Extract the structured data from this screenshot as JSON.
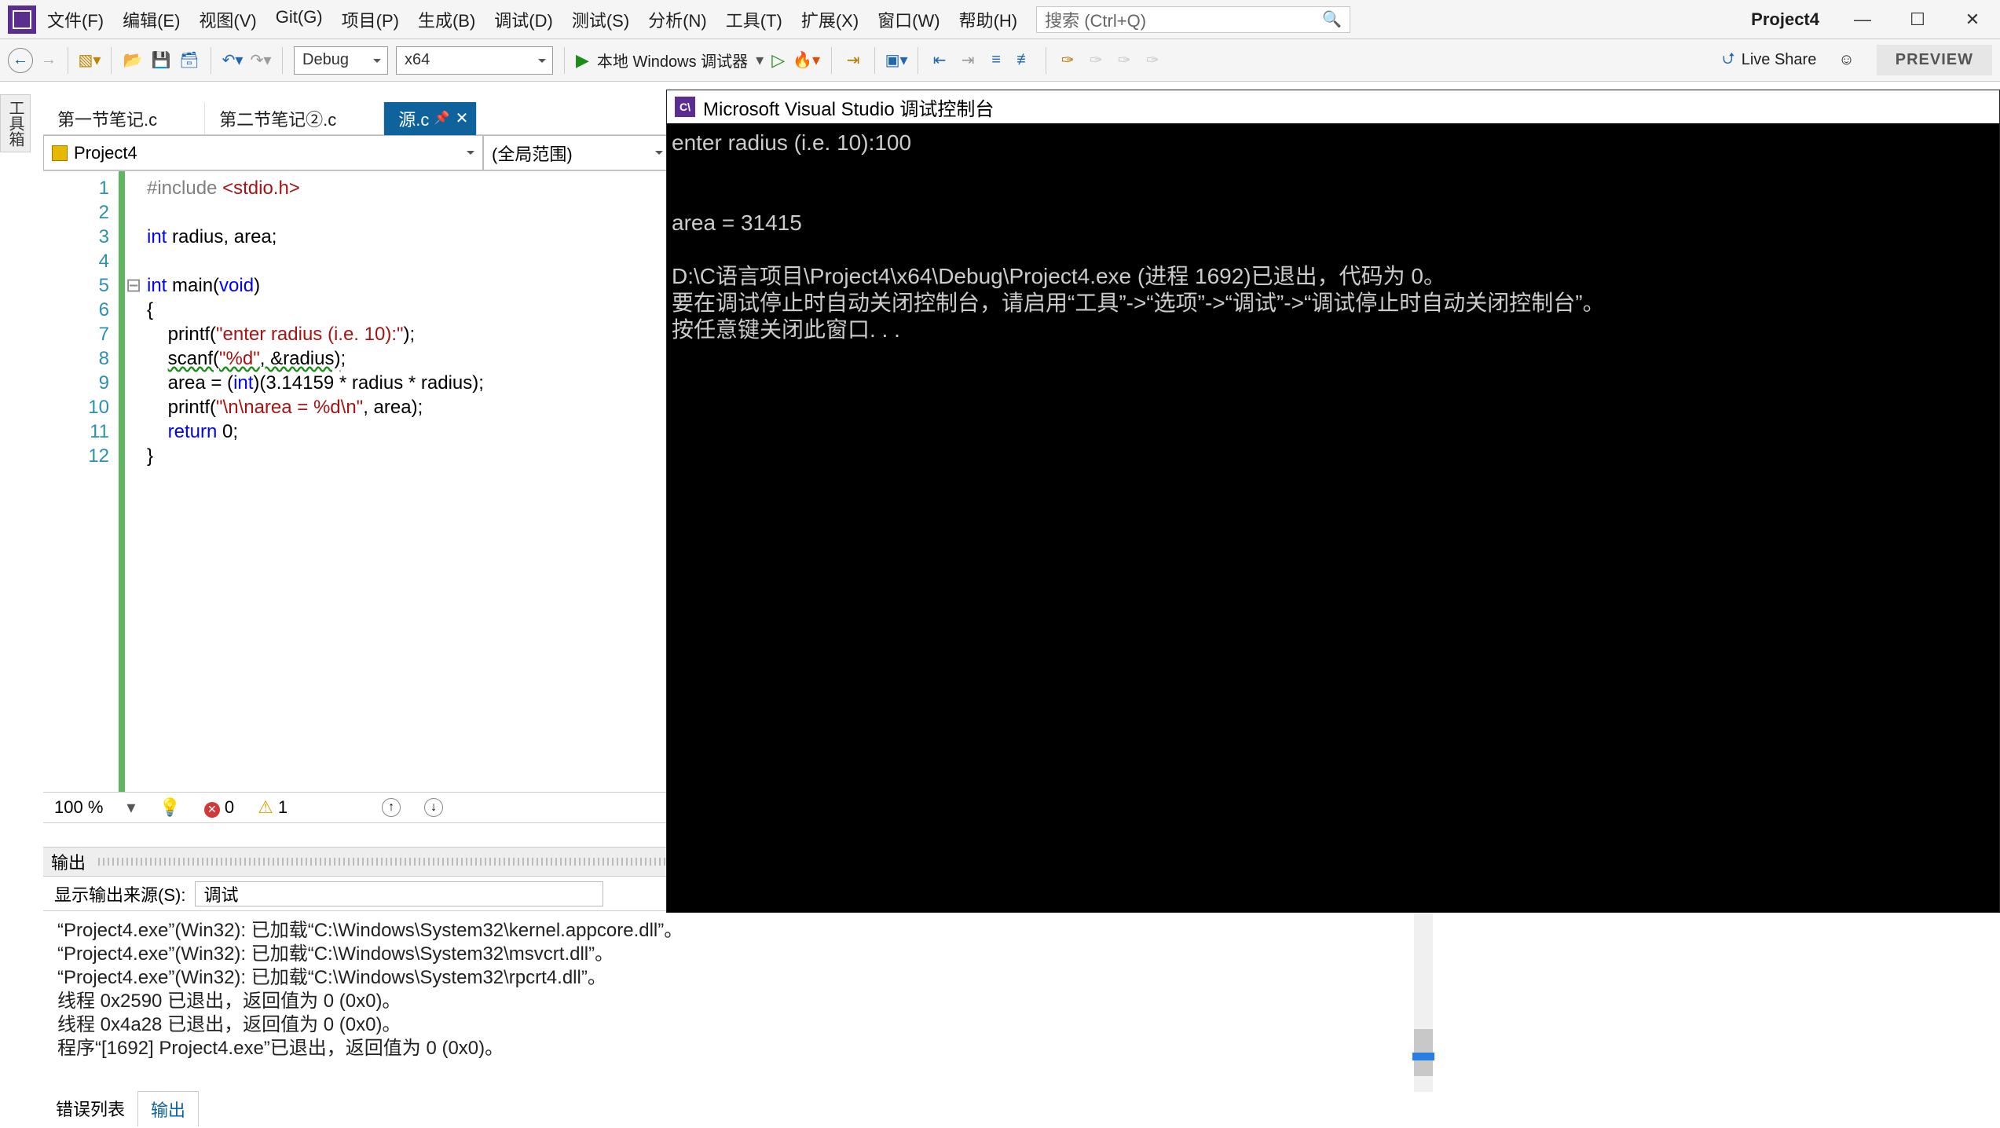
{
  "title": {
    "project": "Project4"
  },
  "menu": [
    "文件(F)",
    "编辑(E)",
    "视图(V)",
    "Git(G)",
    "项目(P)",
    "生成(B)",
    "调试(D)",
    "测试(S)",
    "分析(N)",
    "工具(T)",
    "扩展(X)",
    "窗口(W)",
    "帮助(H)"
  ],
  "search": {
    "placeholder": "搜索 (Ctrl+Q)"
  },
  "window_buttons": {
    "min": "—",
    "max": "☐",
    "close": "✕"
  },
  "toolbar": {
    "config": "Debug",
    "platform": "x64",
    "debugger": "本地 Windows 调试器",
    "live_share": "Live Share",
    "preview": "PREVIEW"
  },
  "left_tool": "工具箱",
  "tabs": [
    {
      "label": "第一节笔记.c",
      "active": false
    },
    {
      "label": "第二节笔记②.c",
      "active": false
    },
    {
      "label": "源.c",
      "active": true
    }
  ],
  "nav": {
    "scope": "Project4",
    "member": "(全局范围)"
  },
  "code": {
    "lines": [
      "1",
      "2",
      "3",
      "4",
      "5",
      "6",
      "7",
      "8",
      "9",
      "10",
      "11",
      "12"
    ]
  },
  "editor_status": {
    "zoom": "100 %",
    "errors": "0",
    "warnings": "1"
  },
  "output": {
    "title": "输出",
    "source_label": "显示输出来源(S):",
    "source_value": "调试",
    "lines": [
      "“Project4.exe”(Win32): 已加载“C:\\Windows\\System32\\kernel.appcore.dll”。",
      "“Project4.exe”(Win32): 已加载“C:\\Windows\\System32\\msvcrt.dll”。",
      "“Project4.exe”(Win32): 已加载“C:\\Windows\\System32\\rpcrt4.dll”。",
      "线程 0x2590 已退出，返回值为 0 (0x0)。",
      "线程 0x4a28 已退出，返回值为 0 (0x0)。",
      "程序“[1692] Project4.exe”已退出，返回值为 0 (0x0)。"
    ]
  },
  "bottom_tabs": {
    "error_list": "错误列表",
    "output": "输出"
  },
  "console": {
    "title": "Microsoft Visual Studio 调试控制台",
    "lines": [
      "enter radius (i.e. 10):100",
      "",
      "",
      "area = 31415",
      "",
      "D:\\C语言项目\\Project4\\x64\\Debug\\Project4.exe (进程 1692)已退出，代码为 0。",
      "要在调试停止时自动关闭控制台，请启用“工具”->“选项”->“调试”->“调试停止时自动关闭控制台”。",
      "按任意键关闭此窗口. . ."
    ]
  }
}
